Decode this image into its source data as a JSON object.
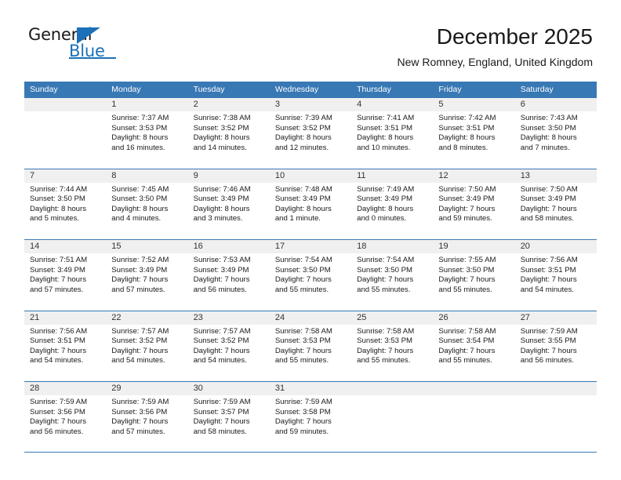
{
  "brand": {
    "name_part1": "General",
    "name_part2": "Blue",
    "accent_color": "#1c70b8"
  },
  "header": {
    "title": "December 2025",
    "location": "New Romney, England, United Kingdom"
  },
  "calendar": {
    "header_color": "#3878b4",
    "weekdays": [
      "Sunday",
      "Monday",
      "Tuesday",
      "Wednesday",
      "Thursday",
      "Friday",
      "Saturday"
    ],
    "weeks": [
      [
        {
          "day": "",
          "sunrise": "",
          "sunset": "",
          "daylight1": "",
          "daylight2": ""
        },
        {
          "day": "1",
          "sunrise": "Sunrise: 7:37 AM",
          "sunset": "Sunset: 3:53 PM",
          "daylight1": "Daylight: 8 hours",
          "daylight2": "and 16 minutes."
        },
        {
          "day": "2",
          "sunrise": "Sunrise: 7:38 AM",
          "sunset": "Sunset: 3:52 PM",
          "daylight1": "Daylight: 8 hours",
          "daylight2": "and 14 minutes."
        },
        {
          "day": "3",
          "sunrise": "Sunrise: 7:39 AM",
          "sunset": "Sunset: 3:52 PM",
          "daylight1": "Daylight: 8 hours",
          "daylight2": "and 12 minutes."
        },
        {
          "day": "4",
          "sunrise": "Sunrise: 7:41 AM",
          "sunset": "Sunset: 3:51 PM",
          "daylight1": "Daylight: 8 hours",
          "daylight2": "and 10 minutes."
        },
        {
          "day": "5",
          "sunrise": "Sunrise: 7:42 AM",
          "sunset": "Sunset: 3:51 PM",
          "daylight1": "Daylight: 8 hours",
          "daylight2": "and 8 minutes."
        },
        {
          "day": "6",
          "sunrise": "Sunrise: 7:43 AM",
          "sunset": "Sunset: 3:50 PM",
          "daylight1": "Daylight: 8 hours",
          "daylight2": "and 7 minutes."
        }
      ],
      [
        {
          "day": "7",
          "sunrise": "Sunrise: 7:44 AM",
          "sunset": "Sunset: 3:50 PM",
          "daylight1": "Daylight: 8 hours",
          "daylight2": "and 5 minutes."
        },
        {
          "day": "8",
          "sunrise": "Sunrise: 7:45 AM",
          "sunset": "Sunset: 3:50 PM",
          "daylight1": "Daylight: 8 hours",
          "daylight2": "and 4 minutes."
        },
        {
          "day": "9",
          "sunrise": "Sunrise: 7:46 AM",
          "sunset": "Sunset: 3:49 PM",
          "daylight1": "Daylight: 8 hours",
          "daylight2": "and 3 minutes."
        },
        {
          "day": "10",
          "sunrise": "Sunrise: 7:48 AM",
          "sunset": "Sunset: 3:49 PM",
          "daylight1": "Daylight: 8 hours",
          "daylight2": "and 1 minute."
        },
        {
          "day": "11",
          "sunrise": "Sunrise: 7:49 AM",
          "sunset": "Sunset: 3:49 PM",
          "daylight1": "Daylight: 8 hours",
          "daylight2": "and 0 minutes."
        },
        {
          "day": "12",
          "sunrise": "Sunrise: 7:50 AM",
          "sunset": "Sunset: 3:49 PM",
          "daylight1": "Daylight: 7 hours",
          "daylight2": "and 59 minutes."
        },
        {
          "day": "13",
          "sunrise": "Sunrise: 7:50 AM",
          "sunset": "Sunset: 3:49 PM",
          "daylight1": "Daylight: 7 hours",
          "daylight2": "and 58 minutes."
        }
      ],
      [
        {
          "day": "14",
          "sunrise": "Sunrise: 7:51 AM",
          "sunset": "Sunset: 3:49 PM",
          "daylight1": "Daylight: 7 hours",
          "daylight2": "and 57 minutes."
        },
        {
          "day": "15",
          "sunrise": "Sunrise: 7:52 AM",
          "sunset": "Sunset: 3:49 PM",
          "daylight1": "Daylight: 7 hours",
          "daylight2": "and 57 minutes."
        },
        {
          "day": "16",
          "sunrise": "Sunrise: 7:53 AM",
          "sunset": "Sunset: 3:49 PM",
          "daylight1": "Daylight: 7 hours",
          "daylight2": "and 56 minutes."
        },
        {
          "day": "17",
          "sunrise": "Sunrise: 7:54 AM",
          "sunset": "Sunset: 3:50 PM",
          "daylight1": "Daylight: 7 hours",
          "daylight2": "and 55 minutes."
        },
        {
          "day": "18",
          "sunrise": "Sunrise: 7:54 AM",
          "sunset": "Sunset: 3:50 PM",
          "daylight1": "Daylight: 7 hours",
          "daylight2": "and 55 minutes."
        },
        {
          "day": "19",
          "sunrise": "Sunrise: 7:55 AM",
          "sunset": "Sunset: 3:50 PM",
          "daylight1": "Daylight: 7 hours",
          "daylight2": "and 55 minutes."
        },
        {
          "day": "20",
          "sunrise": "Sunrise: 7:56 AM",
          "sunset": "Sunset: 3:51 PM",
          "daylight1": "Daylight: 7 hours",
          "daylight2": "and 54 minutes."
        }
      ],
      [
        {
          "day": "21",
          "sunrise": "Sunrise: 7:56 AM",
          "sunset": "Sunset: 3:51 PM",
          "daylight1": "Daylight: 7 hours",
          "daylight2": "and 54 minutes."
        },
        {
          "day": "22",
          "sunrise": "Sunrise: 7:57 AM",
          "sunset": "Sunset: 3:52 PM",
          "daylight1": "Daylight: 7 hours",
          "daylight2": "and 54 minutes."
        },
        {
          "day": "23",
          "sunrise": "Sunrise: 7:57 AM",
          "sunset": "Sunset: 3:52 PM",
          "daylight1": "Daylight: 7 hours",
          "daylight2": "and 54 minutes."
        },
        {
          "day": "24",
          "sunrise": "Sunrise: 7:58 AM",
          "sunset": "Sunset: 3:53 PM",
          "daylight1": "Daylight: 7 hours",
          "daylight2": "and 55 minutes."
        },
        {
          "day": "25",
          "sunrise": "Sunrise: 7:58 AM",
          "sunset": "Sunset: 3:53 PM",
          "daylight1": "Daylight: 7 hours",
          "daylight2": "and 55 minutes."
        },
        {
          "day": "26",
          "sunrise": "Sunrise: 7:58 AM",
          "sunset": "Sunset: 3:54 PM",
          "daylight1": "Daylight: 7 hours",
          "daylight2": "and 55 minutes."
        },
        {
          "day": "27",
          "sunrise": "Sunrise: 7:59 AM",
          "sunset": "Sunset: 3:55 PM",
          "daylight1": "Daylight: 7 hours",
          "daylight2": "and 56 minutes."
        }
      ],
      [
        {
          "day": "28",
          "sunrise": "Sunrise: 7:59 AM",
          "sunset": "Sunset: 3:56 PM",
          "daylight1": "Daylight: 7 hours",
          "daylight2": "and 56 minutes."
        },
        {
          "day": "29",
          "sunrise": "Sunrise: 7:59 AM",
          "sunset": "Sunset: 3:56 PM",
          "daylight1": "Daylight: 7 hours",
          "daylight2": "and 57 minutes."
        },
        {
          "day": "30",
          "sunrise": "Sunrise: 7:59 AM",
          "sunset": "Sunset: 3:57 PM",
          "daylight1": "Daylight: 7 hours",
          "daylight2": "and 58 minutes."
        },
        {
          "day": "31",
          "sunrise": "Sunrise: 7:59 AM",
          "sunset": "Sunset: 3:58 PM",
          "daylight1": "Daylight: 7 hours",
          "daylight2": "and 59 minutes."
        },
        {
          "day": "",
          "sunrise": "",
          "sunset": "",
          "daylight1": "",
          "daylight2": ""
        },
        {
          "day": "",
          "sunrise": "",
          "sunset": "",
          "daylight1": "",
          "daylight2": ""
        },
        {
          "day": "",
          "sunrise": "",
          "sunset": "",
          "daylight1": "",
          "daylight2": ""
        }
      ]
    ]
  }
}
